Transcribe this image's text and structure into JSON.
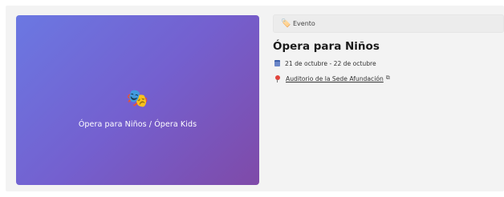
{
  "event_card": {
    "banner": {
      "emoji": "🎭",
      "title": "Ópera para Niños / Ópera Kids"
    },
    "type_badge": {
      "icon": "🏷️",
      "label": "Evento"
    },
    "title": "Ópera para Niños",
    "date_range": "21 de octubre - 22 de octubre",
    "venue": {
      "label": "Auditorio de la Sede Afundación",
      "external_icon": "⧉"
    },
    "colors": {
      "banner_gradient_start": "#6b78e2",
      "banner_gradient_end": "#7f4aa8",
      "card_background": "#f3f3f3",
      "calendar_icon": "#3c5fa8",
      "pin_icon": "#e2443c"
    }
  }
}
